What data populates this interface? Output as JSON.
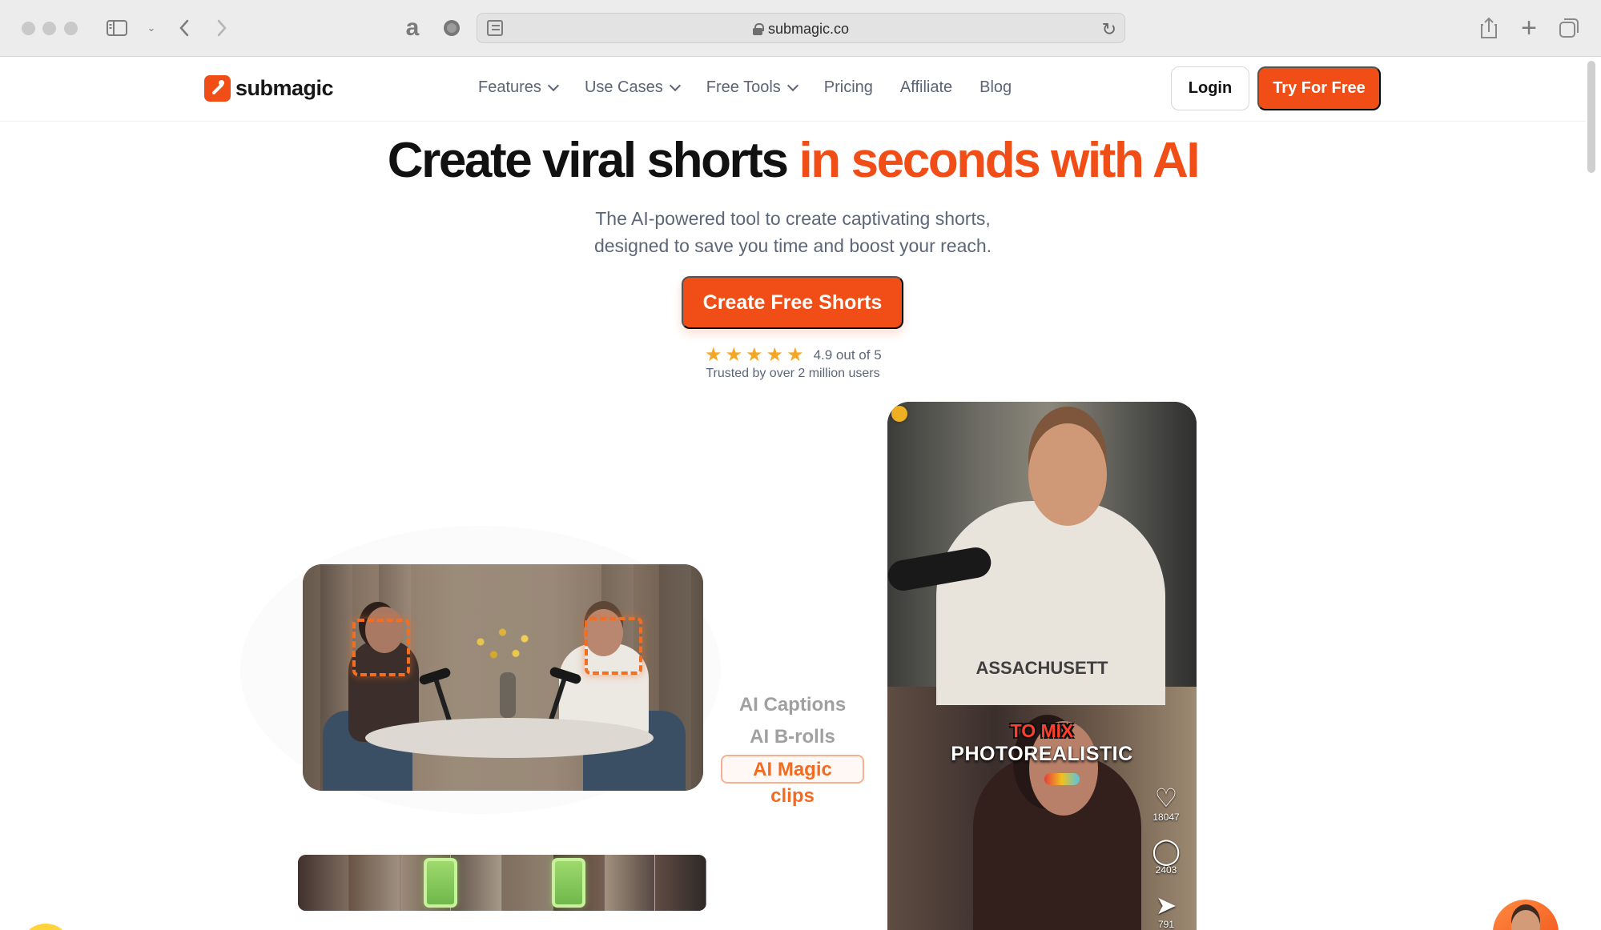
{
  "browser": {
    "address": "submagic.co",
    "toolbar_icons": [
      "sidebar-icon",
      "chevron-down-icon",
      "back-icon",
      "forward-icon",
      "amazon-icon",
      "record-icon",
      "share-icon",
      "plus-icon",
      "tabs-icon",
      "reload-icon"
    ]
  },
  "header": {
    "brand": "submagic",
    "nav": [
      {
        "label": "Features",
        "has_dropdown": true
      },
      {
        "label": "Use Cases",
        "has_dropdown": true
      },
      {
        "label": "Free Tools",
        "has_dropdown": true
      },
      {
        "label": "Pricing",
        "has_dropdown": false
      },
      {
        "label": "Affiliate",
        "has_dropdown": false
      },
      {
        "label": "Blog",
        "has_dropdown": false
      }
    ],
    "login_label": "Login",
    "try_label": "Try For Free"
  },
  "hero": {
    "title_main": "Create viral shorts",
    "title_accent": "in seconds with AI",
    "subtitle_line_1": "The AI-powered tool to create captivating shorts,",
    "subtitle_line_2": "designed to save you time and boost your reach.",
    "cta_label": "Create Free Shorts",
    "rating_text": "4.9 out of 5",
    "rating_value": 4.9,
    "stars_shown": 5,
    "trusted_text": "Trusted by over 2 million users"
  },
  "showcase": {
    "features": [
      "AI Captions",
      "AI B-rolls",
      "AI Magic clips"
    ],
    "active_feature": "AI Magic clips",
    "phone": {
      "shirt_text": "ASSACHUSETT",
      "highlight_caption": "TO MIX",
      "main_caption": "PHOTOREALISTIC",
      "likes": "18047",
      "comments": "2403",
      "shares": "791"
    }
  },
  "colors": {
    "accent": "#f04e16",
    "text_dark": "#111111",
    "text_muted": "#5d6678",
    "star": "#f5a623",
    "feature_muted": "#a0a0a0"
  }
}
